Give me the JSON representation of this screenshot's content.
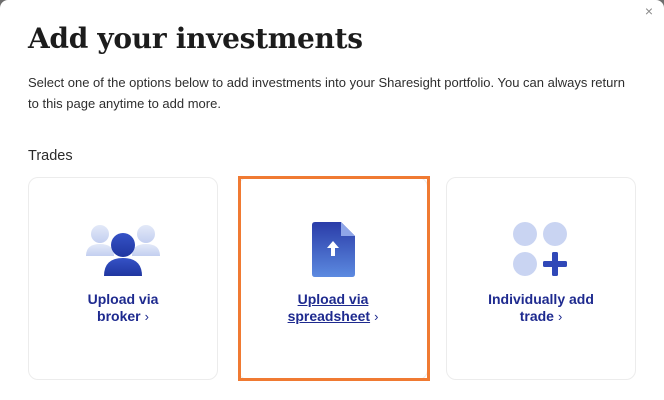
{
  "modal": {
    "title": "Add your investments",
    "description": "Select one of the options below to add investments into your Sharesight portfolio. You can always return to this page anytime to add more.",
    "close_icon": "×"
  },
  "trades": {
    "section_label": "Trades",
    "cards": [
      {
        "line1": "Upload via",
        "line2": "broker",
        "icon": "users-icon"
      },
      {
        "line1": "Upload via",
        "line2": "spreadsheet",
        "icon": "file-upload-icon"
      },
      {
        "line1": "Individually add",
        "line2": "trade",
        "icon": "grid-add-icon"
      }
    ],
    "chevron": "›"
  },
  "colors": {
    "accent": "#1e2a8f",
    "highlight": "#f07a32",
    "icon_light": "#c9d4f2",
    "icon_dark": "#3048b8"
  }
}
